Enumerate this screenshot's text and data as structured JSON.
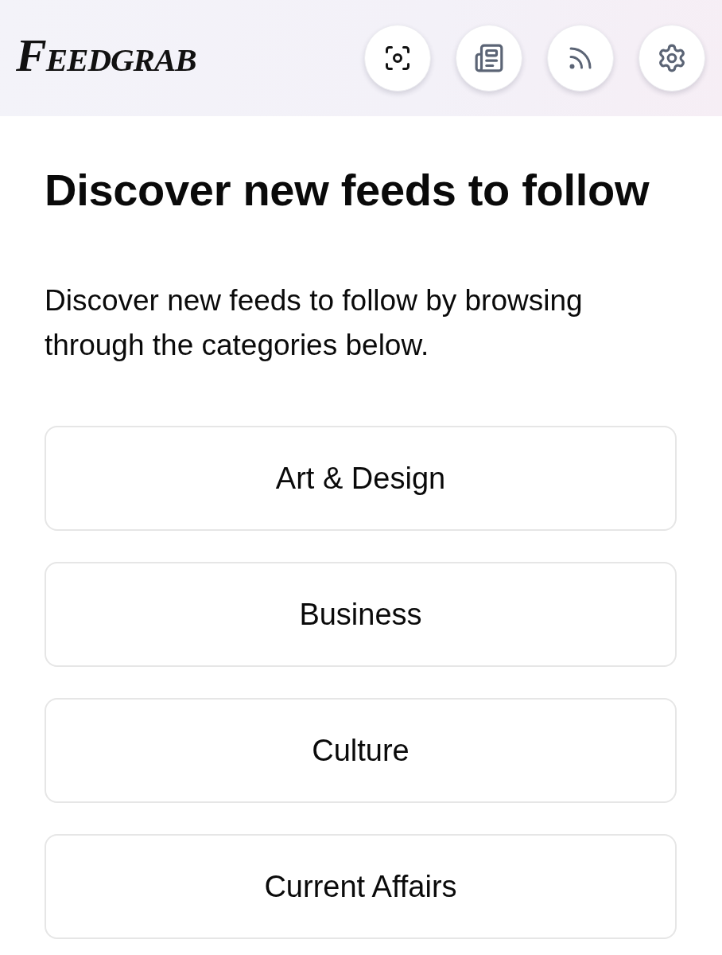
{
  "header": {
    "logo": "Feedgrab",
    "buttons": [
      {
        "kind": "scan"
      },
      {
        "kind": "newspaper"
      },
      {
        "kind": "rss"
      },
      {
        "kind": "settings"
      }
    ]
  },
  "main": {
    "title": "Discover new feeds to follow",
    "intro": "Discover new feeds to follow by browsing through the categories below.",
    "categories": [
      {
        "label": "Art & Design"
      },
      {
        "label": "Business"
      },
      {
        "label": "Culture"
      },
      {
        "label": "Current Affairs"
      }
    ]
  }
}
